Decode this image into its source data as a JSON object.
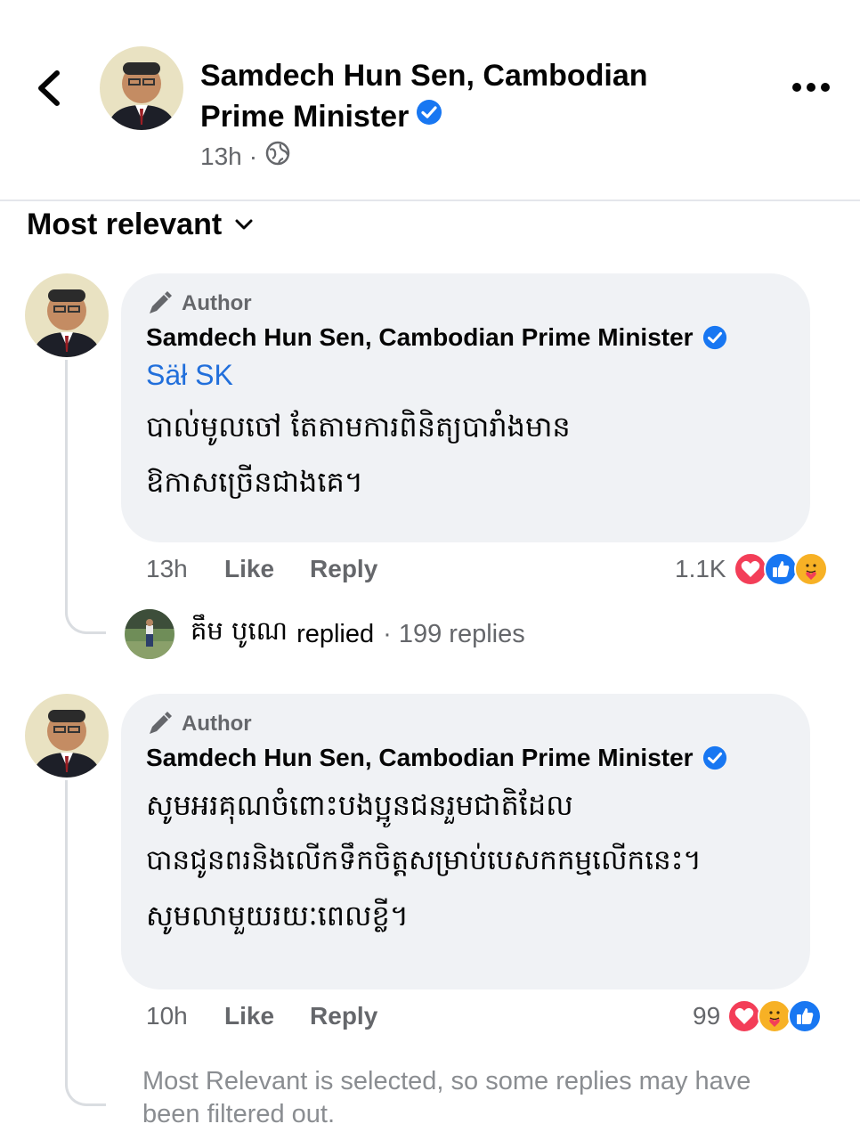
{
  "header": {
    "back_icon": "chevron-left-icon",
    "page_name": "Samdech Hun Sen, Cambodian Prime Minister",
    "time": "13h",
    "separator": "·",
    "privacy_icon": "globe-icon",
    "more_icon": "more-horizontal-icon"
  },
  "sort": {
    "label": "Most relevant",
    "icon": "chevron-down-icon"
  },
  "comments": [
    {
      "author_badge": "Author",
      "name": "Samdech Hun Sen, Cambodian Prime Minister",
      "mention": "Säł SK",
      "text_lines": [
        "បាល់មូលចៅ តែតាមការពិនិត្យបារាំងមាន",
        "ឱកាសច្រើនជាងគេ។"
      ],
      "time": "13h",
      "like_label": "Like",
      "reply_label": "Reply",
      "reaction_count": "1.1K",
      "reaction_icons": [
        "love-icon",
        "like-icon",
        "care-icon"
      ]
    },
    {
      "author_badge": "Author",
      "name": "Samdech Hun Sen, Cambodian Prime Minister",
      "text_lines": [
        "សូមអរគុណចំពោះបងប្អូនជនរួមជាតិដែល",
        "បានជូនពរនិងលើកទឹកចិត្តសម្រាប់បេសកកម្មលើកនេះ។",
        "សូមលាមួយរយៈពេលខ្លី។"
      ],
      "time": "10h",
      "like_label": "Like",
      "reply_label": "Reply",
      "reaction_count": "99",
      "reaction_icons": [
        "love-icon",
        "care-icon",
        "like-icon"
      ]
    }
  ],
  "reply_preview": {
    "name": "គឹម បូណេ",
    "action": "replied",
    "count": "· 199 replies"
  },
  "filter_note": "Most Relevant is selected, so some replies may have been filtered out.",
  "colors": {
    "verified": "#1877f2",
    "link": "#216fdb",
    "secondary_text": "#65676b",
    "bubble": "#f0f2f5",
    "love": "#f33e58",
    "like": "#1877f2",
    "care": "#f7b125"
  }
}
